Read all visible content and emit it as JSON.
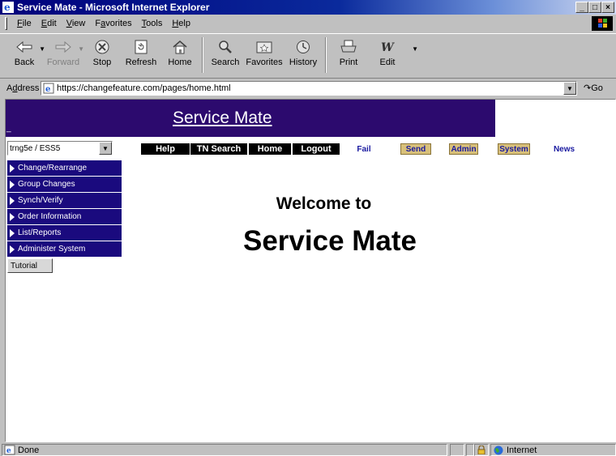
{
  "window": {
    "title": "Service Mate - Microsoft Internet Explorer",
    "buttons": [
      "_",
      "□",
      "×"
    ]
  },
  "menu": [
    {
      "key": "F",
      "rest": "ile",
      "pre": ""
    },
    {
      "key": "E",
      "rest": "dit",
      "pre": ""
    },
    {
      "key": "V",
      "rest": "iew",
      "pre": ""
    },
    {
      "key": "a",
      "rest": "vorites",
      "pre": "F"
    },
    {
      "key": "T",
      "rest": "ools",
      "pre": ""
    },
    {
      "key": "H",
      "rest": "elp",
      "pre": ""
    }
  ],
  "toolbar": {
    "back": "Back",
    "forward": "Forward",
    "stop": "Stop",
    "refresh": "Refresh",
    "home": "Home",
    "search": "Search",
    "favorites": "Favorites",
    "history": "History",
    "print": "Print",
    "edit": "Edit"
  },
  "address": {
    "label_key": "d",
    "label_pre": "A",
    "label_rest": "dress",
    "url": "https://changefeature.com/pages/home.html",
    "go": "Go"
  },
  "page": {
    "banner_title": "Service Mate",
    "banner_dash": "_",
    "scope_value": "trng5e / ESS5",
    "nav_buttons": [
      "Help",
      "TN Search",
      "Home",
      "Logout"
    ],
    "nav_links": [
      "Fail",
      "Send",
      "Admin",
      "System",
      "News"
    ],
    "side_menu": [
      "Change/Rearrange",
      "Group Changes",
      "Synch/Verify",
      "Order Information",
      "List/Reports",
      "Administer System"
    ],
    "tutorial": "Tutorial",
    "welcome": "Welcome to",
    "app_name": "Service Mate"
  },
  "status": {
    "text": "Done",
    "zone": "Internet"
  },
  "colors": {
    "banner": "#2c0a6e",
    "side_menu": "#1a0a7e",
    "link": "#1a1aa0",
    "link_box": "#d8c07a"
  }
}
